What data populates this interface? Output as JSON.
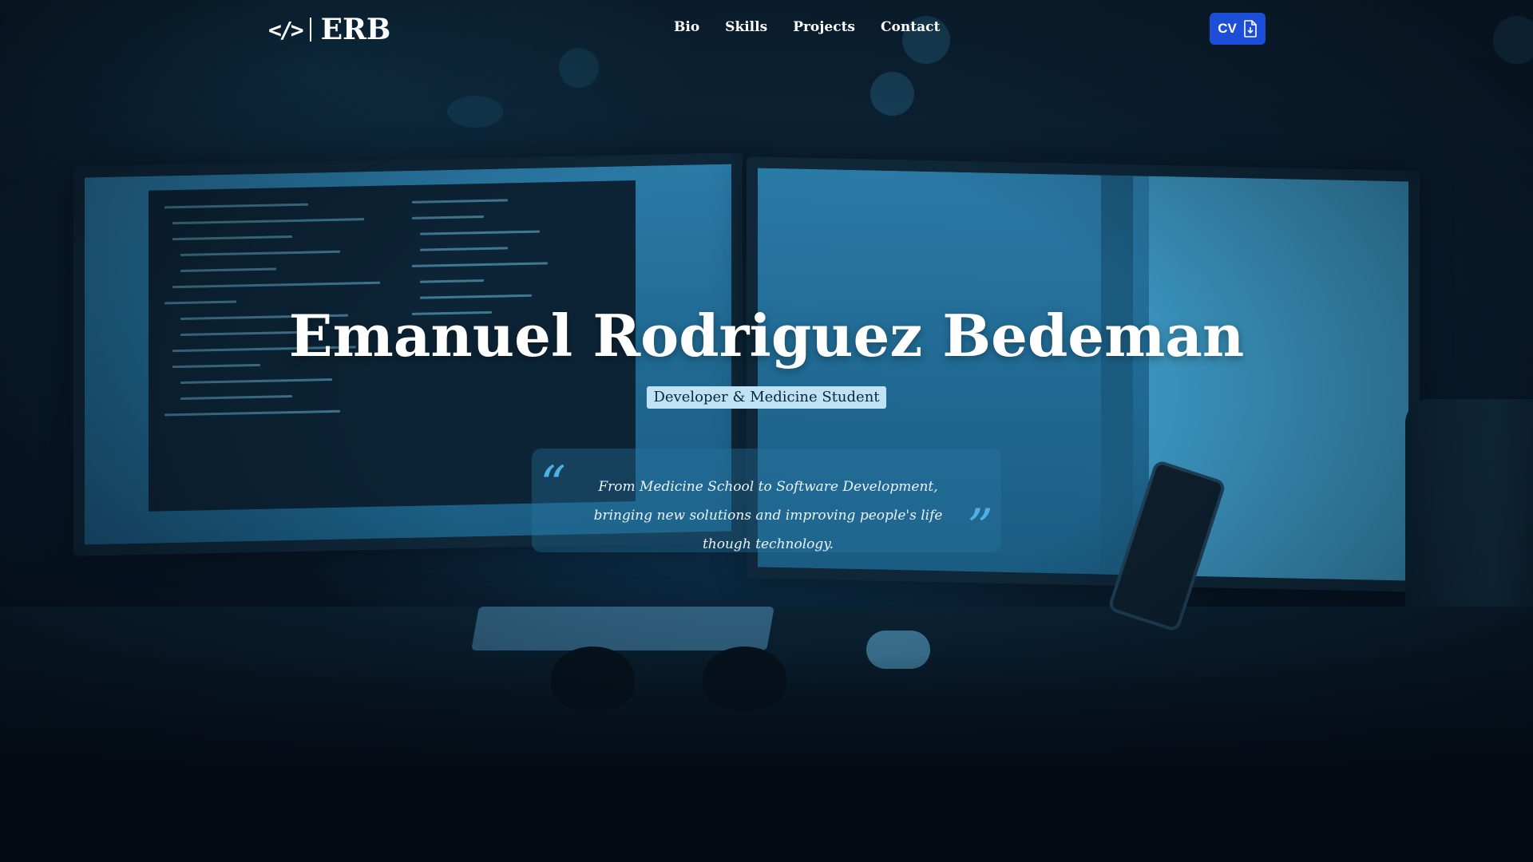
{
  "header": {
    "logo_icon": "</>",
    "logo_text": "ERB",
    "nav": [
      {
        "label": "Bio"
      },
      {
        "label": "Skills"
      },
      {
        "label": "Projects"
      },
      {
        "label": "Contact"
      }
    ],
    "cv_label": "CV",
    "cv_icon": "file-download-icon"
  },
  "hero": {
    "name": "Emanuel Rodriguez Bedeman",
    "subtitle": "Developer & Medicine Student",
    "quote": "From Medicine School to Software Development, bringing new solutions and improving people's life though technology.",
    "quote_open_mark": "“",
    "quote_close_mark": "”"
  },
  "colors": {
    "accent": "#1d4ed8",
    "quote_mark": "#4fb0e6",
    "subtitle_bg": "#bfe3f5",
    "overlay": "#0a2033"
  }
}
